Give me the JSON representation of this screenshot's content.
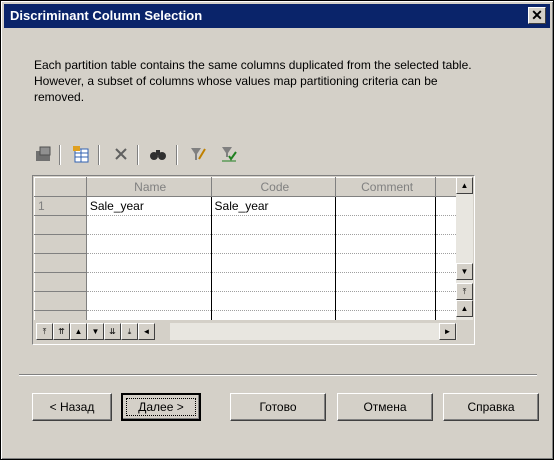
{
  "window": {
    "title": "Discriminant Column Selection",
    "close_glyph": "✕"
  },
  "description": "Each partition table contains the same columns duplicated from the selected table. However, a subset of columns whose values map partitioning criteria can be removed.",
  "toolbar": {
    "buttons": [
      {
        "name": "properties-icon"
      },
      {
        "name": "add-columns-icon"
      },
      {
        "name": "delete-icon"
      },
      {
        "name": "find-icon"
      },
      {
        "name": "filter-icon"
      },
      {
        "name": "filter-clear-icon"
      }
    ]
  },
  "grid": {
    "columns": [
      "Name",
      "Code",
      "Comment"
    ],
    "rows": [
      {
        "num": "1",
        "name": "Sale_year",
        "code": "Sale_year",
        "comment": ""
      }
    ],
    "nav_glyphs": [
      "⤒",
      "⇈",
      "▲",
      "▼",
      "⇊",
      "⤓",
      "◄",
      "►"
    ],
    "scroll_glyphs": [
      "▲",
      "▼",
      "⤒",
      "▲",
      "▼"
    ]
  },
  "buttons": {
    "back": "< Назад",
    "next": "Далее >",
    "finish": "Готово",
    "cancel": "Отмена",
    "help": "Справка"
  }
}
